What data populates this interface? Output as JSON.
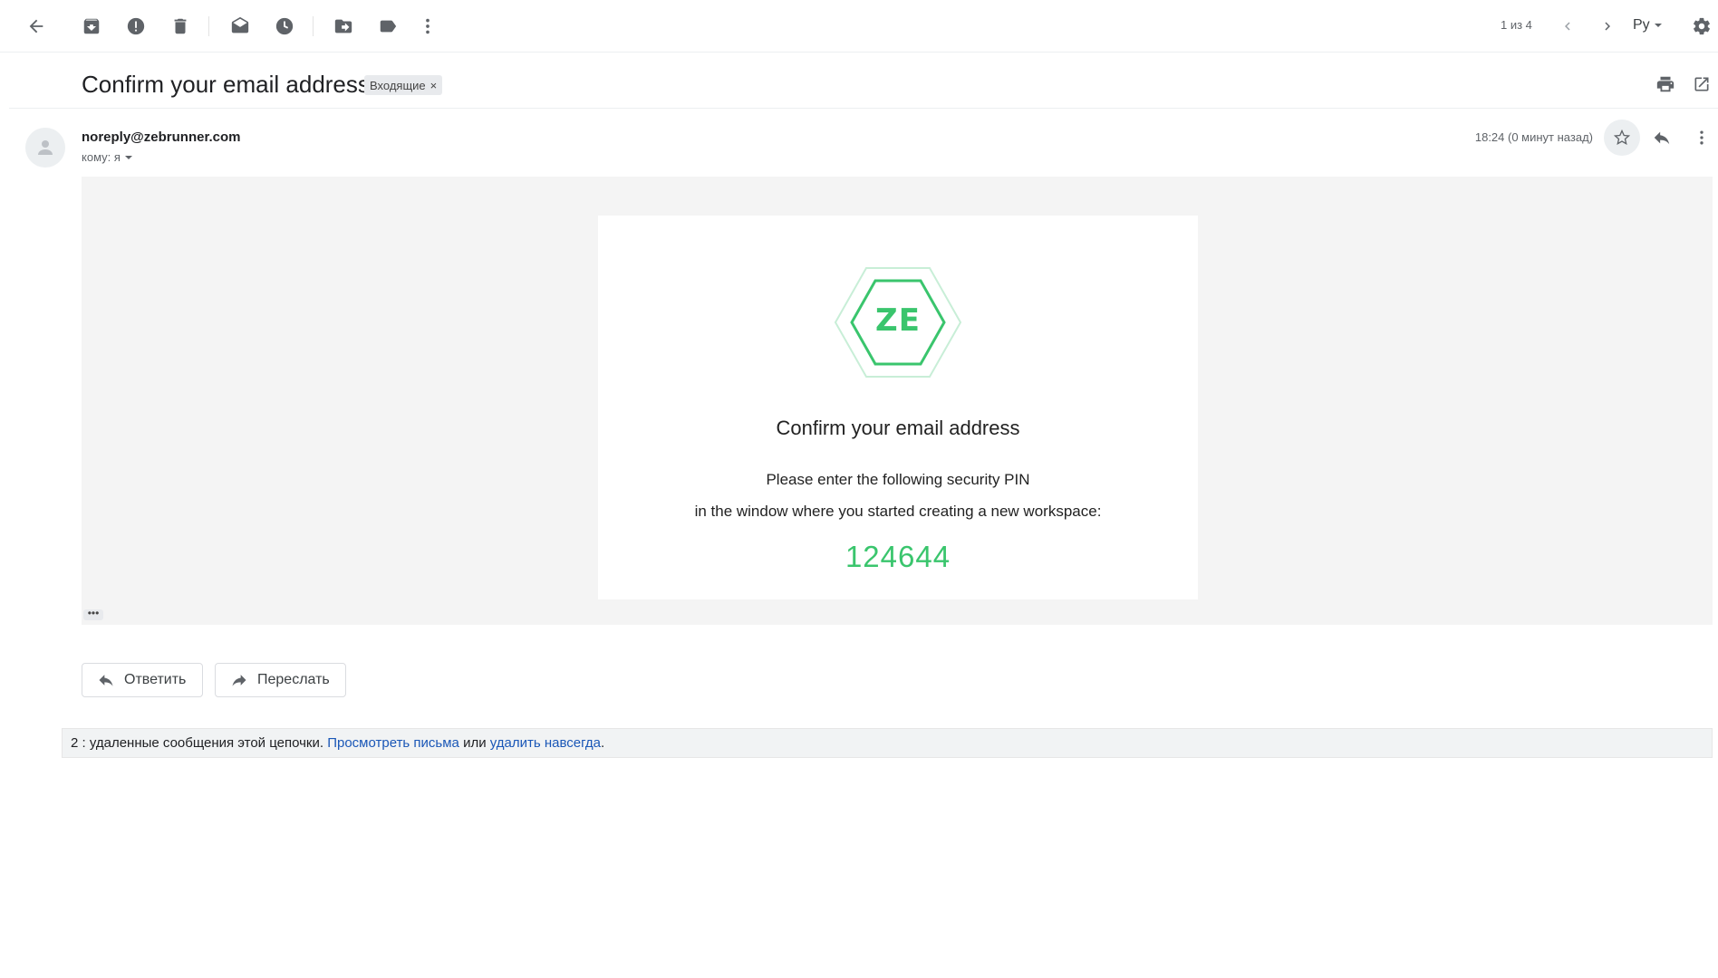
{
  "toolbar": {
    "icons": [
      "back-arrow-icon",
      "archive-icon",
      "report-spam-icon",
      "delete-icon",
      "mark-unread-icon",
      "snooze-icon",
      "move-to-icon",
      "label-icon",
      "more-vert-icon"
    ],
    "pagination": "1 из 4",
    "input_tool": "Ру"
  },
  "subject": {
    "title": "Confirm your email address",
    "label": "Входящие",
    "label_remove": "×"
  },
  "message": {
    "sender": "noreply@zebrunner.com",
    "to_prefix": "кому: я",
    "time": "18:24 (0 минут назад)"
  },
  "email_body": {
    "logo_text": "ZE",
    "heading": "Confirm your email address",
    "line1": "Please enter the following security PIN",
    "line2": "in the window where you started creating a new workspace:",
    "pin": "124644",
    "show_trimmed": "•••"
  },
  "actions": {
    "reply": "Ответить",
    "forward": "Переслать"
  },
  "deleted_notice": {
    "prefix": "2 : удаленные сообщения этой цепочки.",
    "view_link": "Просмотреть письма",
    "or": "или",
    "delete_link": "удалить навсегда",
    "suffix": "."
  },
  "colors": {
    "pin_green": "#3ac56d",
    "link_blue": "#1a57b7",
    "logo_green": "#3ac56d"
  }
}
